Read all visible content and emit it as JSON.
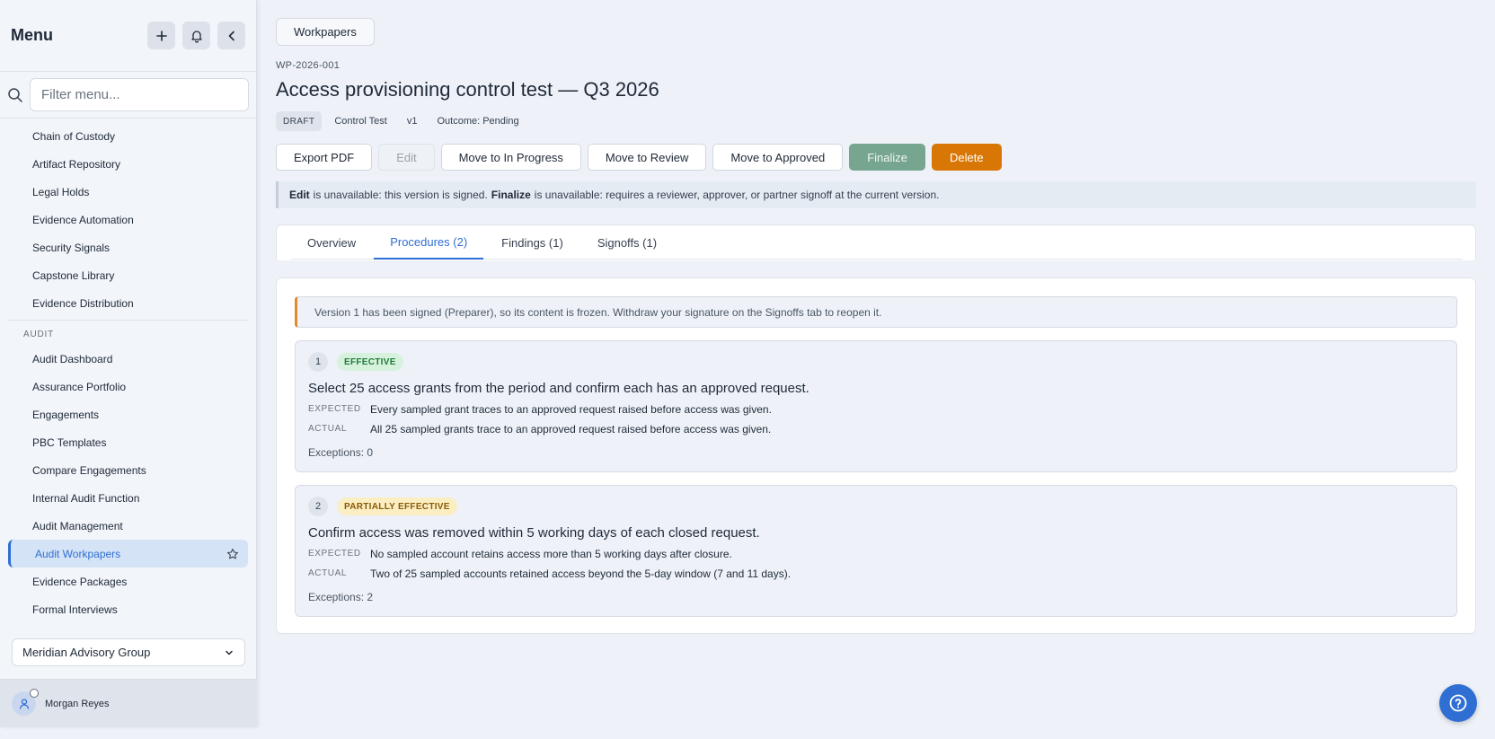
{
  "sidebar": {
    "title": "Menu",
    "search_placeholder": "Filter menu...",
    "items_top": [
      "Chain of Custody",
      "Artifact Repository",
      "Legal Holds",
      "Evidence Automation",
      "Security Signals",
      "Capstone Library",
      "Evidence Distribution"
    ],
    "section_audit": "AUDIT",
    "items_audit": [
      "Audit Dashboard",
      "Assurance Portfolio",
      "Engagements",
      "PBC Templates",
      "Compare Engagements",
      "Internal Audit Function",
      "Audit Management",
      "Audit Workpapers",
      "Evidence Packages",
      "Formal Interviews"
    ],
    "active_item": "Audit Workpapers",
    "org": "Meridian Advisory Group",
    "user": "Morgan Reyes"
  },
  "header": {
    "breadcrumb": "Workpapers",
    "id": "WP-2026-001",
    "title": "Access provisioning control test — Q3 2026",
    "badges": [
      "DRAFT",
      "Control Test",
      "v1",
      "Outcome: Pending"
    ]
  },
  "actions": {
    "export": "Export PDF",
    "edit": "Edit",
    "in_progress": "Move to In Progress",
    "review": "Move to Review",
    "approved": "Move to Approved",
    "finalize": "Finalize",
    "delete": "Delete"
  },
  "notice": {
    "edit_label": "Edit",
    "edit_text": "is unavailable: this version is signed.",
    "finalize_label": "Finalize",
    "finalize_text": "is unavailable: requires a reviewer, approver, or partner signoff at the current version."
  },
  "tabs": [
    "Overview",
    "Procedures (2)",
    "Findings (1)",
    "Signoffs (1)"
  ],
  "frozen_notice": "Version 1 has been signed (Preparer), so its content is frozen. Withdraw your signature on the Signoffs tab to reopen it.",
  "labels": {
    "expected": "EXPECTED",
    "actual": "ACTUAL"
  },
  "procedures": [
    {
      "num": "1",
      "status": "EFFECTIVE",
      "title": "Select 25 access grants from the period and confirm each has an approved request.",
      "expected": "Every sampled grant traces to an approved request raised before access was given.",
      "actual": "All 25 sampled grants trace to an approved request raised before access was given.",
      "exceptions": "Exceptions: 0"
    },
    {
      "num": "2",
      "status": "PARTIALLY EFFECTIVE",
      "title": "Confirm access was removed within 5 working days of each closed request.",
      "expected": "No sampled account retains access more than 5 working days after closure.",
      "actual": "Two of 25 sampled accounts retained access beyond the 5-day window (7 and 11 days).",
      "exceptions": "Exceptions: 2"
    }
  ]
}
